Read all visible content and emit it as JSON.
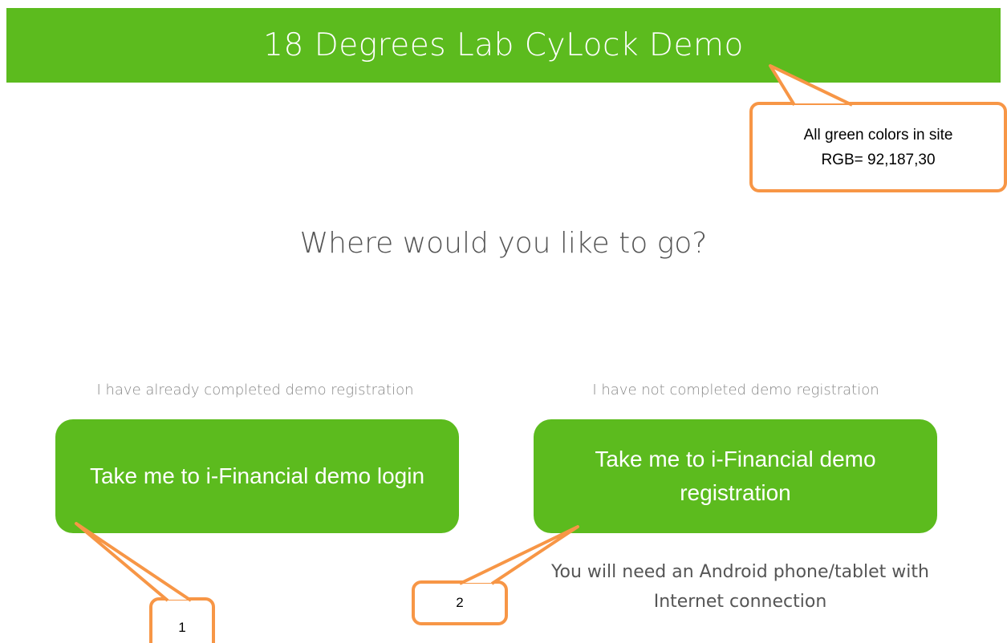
{
  "header": {
    "title": "18 Degrees Lab CyLock Demo"
  },
  "main": {
    "heading": "Where would you like to go?",
    "left": {
      "hint": "I have already completed demo registration",
      "button_label": "Take me to i-Financial demo login"
    },
    "right": {
      "hint": "I have not completed demo registration",
      "button_label": "Take me to i-Financial demo registration",
      "note": "You will need an Android phone/tablet with Internet connection"
    }
  },
  "annotations": {
    "color_note_line1": "All green colors in site",
    "color_note_line2": "RGB= 92,187,30",
    "marker_1": "1",
    "marker_2": "2"
  },
  "colors": {
    "brand_green": "#5CBB1E",
    "callout_orange": "#F79646"
  }
}
